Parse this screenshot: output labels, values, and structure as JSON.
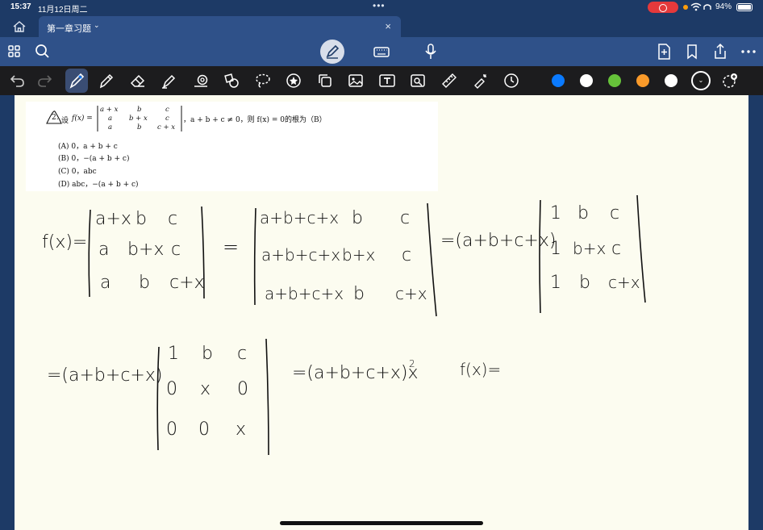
{
  "status_bar": {
    "time": "15:37",
    "date": "11月12日周二",
    "battery": "94%"
  },
  "tab": {
    "title": "第一章习题"
  },
  "problem": {
    "number": "2.",
    "lead": "设",
    "fx": "f(x) =",
    "matrix": [
      [
        "a + x",
        "b",
        "c"
      ],
      [
        "a",
        "b + x",
        "c"
      ],
      [
        "a",
        "b",
        "c + x"
      ]
    ],
    "condition": "，a + b + c ≠ 0，则 f(x) = 0的根为（B）",
    "options": [
      "(A) 0，a + b + c",
      "(B) 0，−(a + b + c)",
      "(C) 0，abc",
      "(D) abc，−(a + b + c)"
    ]
  },
  "handwriting": {
    "fx_label": "f(x)=",
    "det1": [
      [
        "a+x",
        "b",
        "c"
      ],
      [
        "a",
        "b+x",
        "c"
      ],
      [
        "a",
        "b",
        "c+x"
      ]
    ],
    "eq1": "=",
    "det2": [
      [
        "a+b+c+x",
        "b",
        "c"
      ],
      [
        "a+b+c+x",
        "b+x",
        "c"
      ],
      [
        "a+b+c+x",
        "b",
        "c+x"
      ]
    ],
    "factor1": "=(a+b+c+x)",
    "det3": [
      [
        "1",
        "b",
        "c"
      ],
      [
        "1",
        "b+x",
        "c"
      ],
      [
        "1",
        "b",
        "c+x"
      ]
    ],
    "factor2": "=(a+b+c+x)",
    "det4": [
      [
        "1",
        "b",
        "c"
      ],
      [
        "0",
        "x",
        "0"
      ],
      [
        "0",
        "0",
        "x"
      ]
    ],
    "result": "=(a+b+c+x)x",
    "result_exp": "2",
    "fx_tail": "f(x)="
  },
  "colors": {
    "palette": [
      "#0a7aff",
      "#ffffff",
      "#66c23a",
      "#f99a2a",
      "#ffffff"
    ],
    "selected": "#1a1a1a"
  },
  "icons": {
    "toolbar": [
      "grid-icon",
      "search-icon",
      "pen-mode-icon",
      "keyboard-icon",
      "microphone-icon",
      "add-page-icon",
      "bookmark-icon",
      "share-icon",
      "more-icon"
    ],
    "tools": [
      "undo-icon",
      "redo-icon",
      "pen-icon",
      "pencil-icon",
      "eraser-icon",
      "highlighter-icon",
      "shape-icon",
      "element-icon",
      "lasso-icon",
      "sticker-icon",
      "copy-icon",
      "image-icon",
      "text-icon",
      "camera-icon",
      "ruler-icon",
      "laser-pointer-icon",
      "timer-icon"
    ]
  }
}
